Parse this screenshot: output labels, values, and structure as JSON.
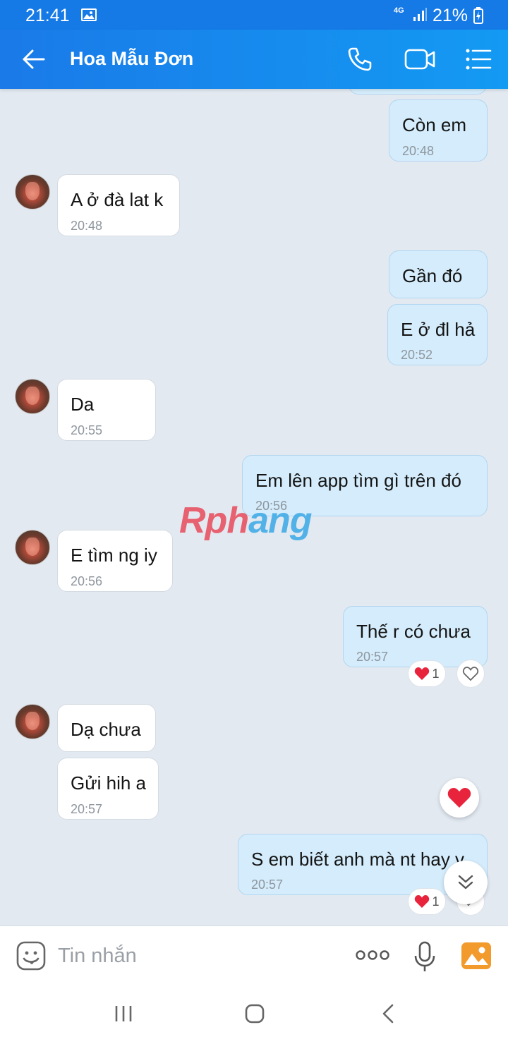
{
  "status_bar": {
    "time": "21:41",
    "network": "4G",
    "battery": "21%"
  },
  "header": {
    "contact_name": "Hoa Mẫu Đơn"
  },
  "messages": [
    {
      "text": "Còn em",
      "time": "20:48"
    },
    {
      "text": "A ở đà lat k",
      "time": "20:48"
    },
    {
      "text": "Gần đó",
      "time": ""
    },
    {
      "text": "E ở đl hả",
      "time": "20:52"
    },
    {
      "text": "Da",
      "time": "20:55"
    },
    {
      "text": "Em lên app tìm gì trên đó",
      "time": "20:56"
    },
    {
      "text": "E tìm ng iy",
      "time": "20:56"
    },
    {
      "text": "Thế r có chưa",
      "time": "20:57"
    },
    {
      "text": "Dạ chưa",
      "time": ""
    },
    {
      "text": "Gửi hih a",
      "time": "20:57"
    },
    {
      "text": "S em biết anh mà nt hay v",
      "time": "20:57"
    }
  ],
  "reactions": [
    {
      "emoji": "heart",
      "count": "1"
    },
    {
      "emoji": "heart",
      "count": "1"
    }
  ],
  "watermark": {
    "part1": "Rph",
    "part2": "ang"
  },
  "composer": {
    "placeholder": "Tin nhắn"
  },
  "colors": {
    "header": "#1a7ae8",
    "outgoing_bubble": "#d4ecfb",
    "incoming_bubble": "#ffffff",
    "background": "#e2e9f1"
  }
}
